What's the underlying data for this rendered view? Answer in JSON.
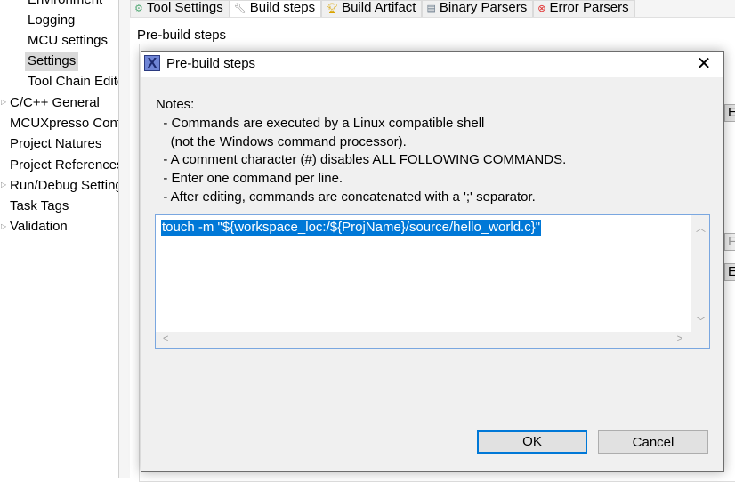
{
  "tree": {
    "items": [
      {
        "label": "Environment",
        "level": 2
      },
      {
        "label": "Logging",
        "level": 2
      },
      {
        "label": "MCU settings",
        "level": 2
      },
      {
        "label": "Settings",
        "level": 2,
        "selected": true
      },
      {
        "label": "Tool Chain Editor",
        "level": 2
      },
      {
        "label": "C/C++ General",
        "level": 1,
        "expandable": true
      },
      {
        "label": "MCUXpresso Config Tools",
        "level": 1
      },
      {
        "label": "Project Natures",
        "level": 1
      },
      {
        "label": "Project References",
        "level": 1
      },
      {
        "label": "Run/Debug Settings",
        "level": 1,
        "expandable": true
      },
      {
        "label": "Task Tags",
        "level": 1
      },
      {
        "label": "Validation",
        "level": 1,
        "expandable": true
      }
    ]
  },
  "tabs": [
    {
      "label": "Tool Settings",
      "icon": "gear-icon"
    },
    {
      "label": "Build steps",
      "icon": "wrench-icon",
      "active": true
    },
    {
      "label": "Build Artifact",
      "icon": "trophy-icon"
    },
    {
      "label": "Binary Parsers",
      "icon": "binary-icon"
    },
    {
      "label": "Error Parsers",
      "icon": "error-icon"
    }
  ],
  "group_label": "Pre-build steps",
  "side_buttons": [
    "Edit...",
    "Fac",
    "Edit..."
  ],
  "dialog": {
    "title": "Pre-build steps",
    "notes": [
      "Notes:",
      "  - Commands are executed by a Linux compatible shell",
      "    (not the Windows command processor).",
      "  - A comment character (#) disables ALL FOLLOWING COMMANDS.",
      "  - Enter one command per line.",
      "  - After editing, commands are concatenated with a ';' separator."
    ],
    "command": "touch -m \"${workspace_loc:/${ProjName}/source/hello_world.c}\"",
    "ok": "OK",
    "cancel": "Cancel"
  }
}
